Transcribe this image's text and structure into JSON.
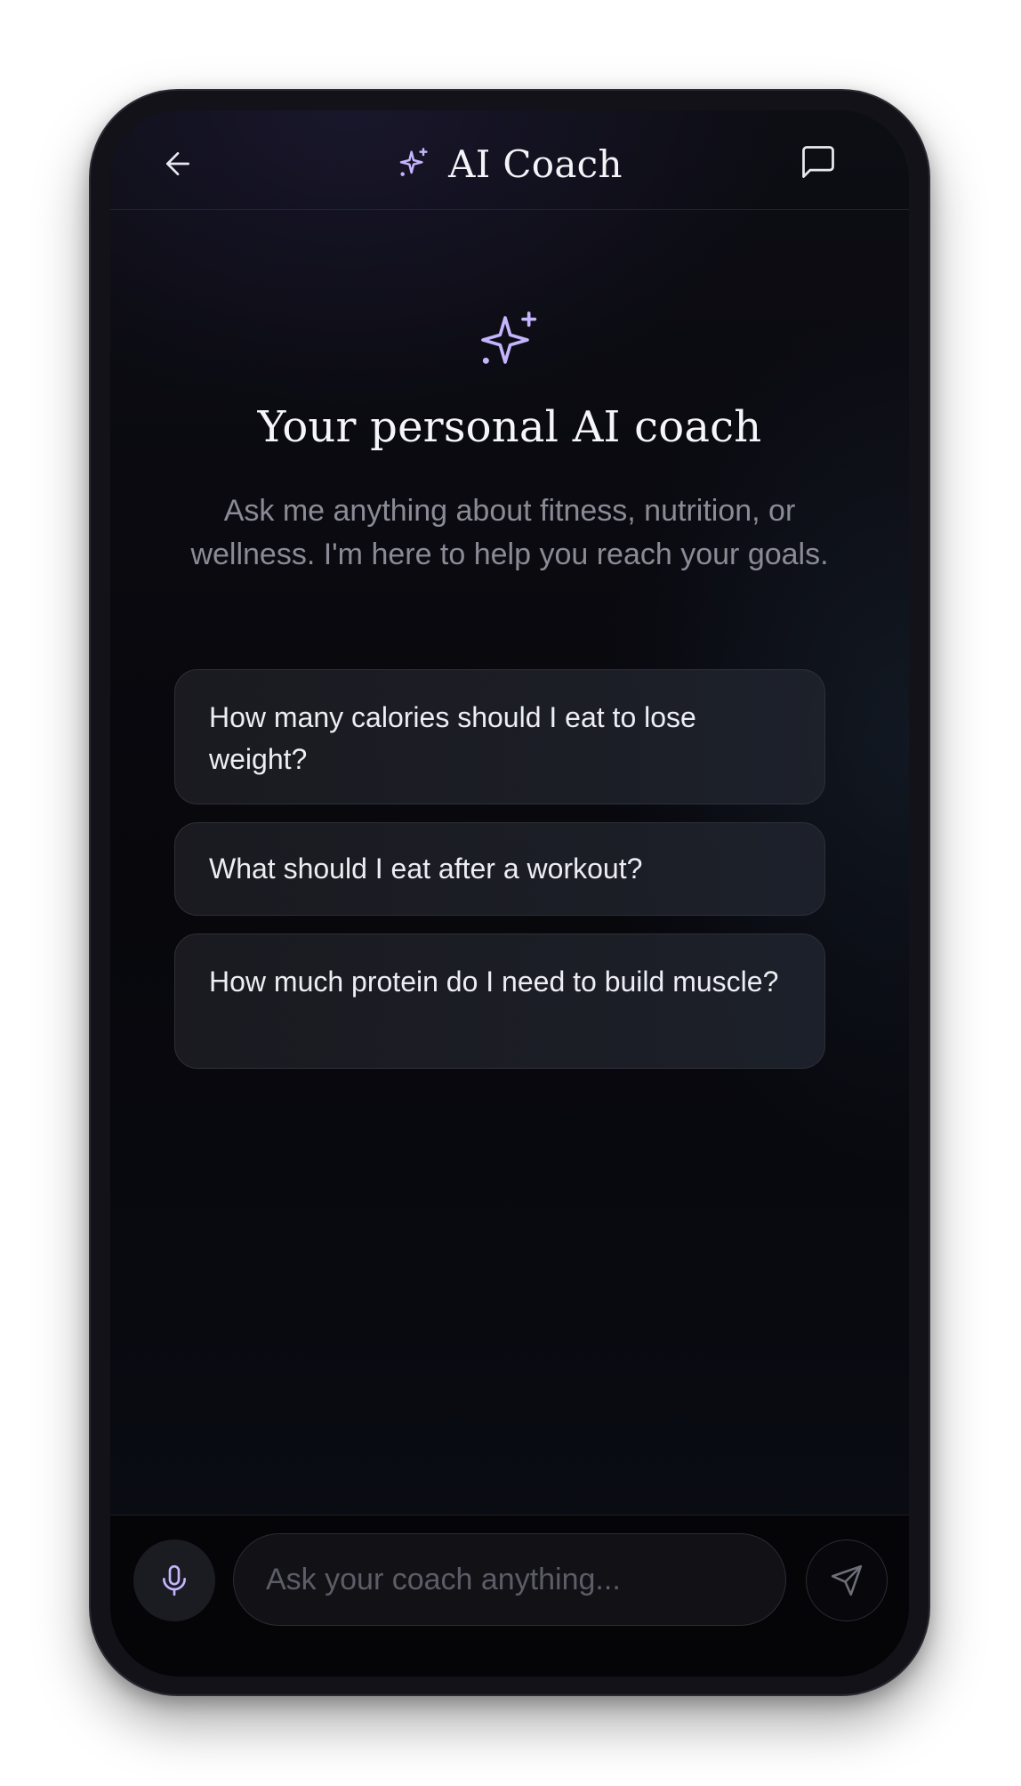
{
  "header": {
    "title": "AI Coach",
    "back_icon": "arrow-left-icon",
    "title_icon": "sparkles-icon",
    "chat_icon": "message-square-icon"
  },
  "hero": {
    "icon": "sparkles-icon",
    "title": "Your personal AI coach",
    "subtitle": "Ask me anything about fitness, nutrition, or wellness. I'm here to help you reach your goals."
  },
  "suggestions": [
    "How many calories should I eat to lose weight?",
    "What should I eat after a workout?",
    "How much protein do I need to build muscle?"
  ],
  "composer": {
    "mic_icon": "microphone-icon",
    "placeholder": "Ask your coach anything...",
    "value": "",
    "send_icon": "send-icon"
  },
  "colors": {
    "accent": "#c4b5fd",
    "background": "#07070c",
    "text_primary": "#f6f6fa",
    "text_secondary": "#8b8b96",
    "card_border": "#2e3038"
  }
}
